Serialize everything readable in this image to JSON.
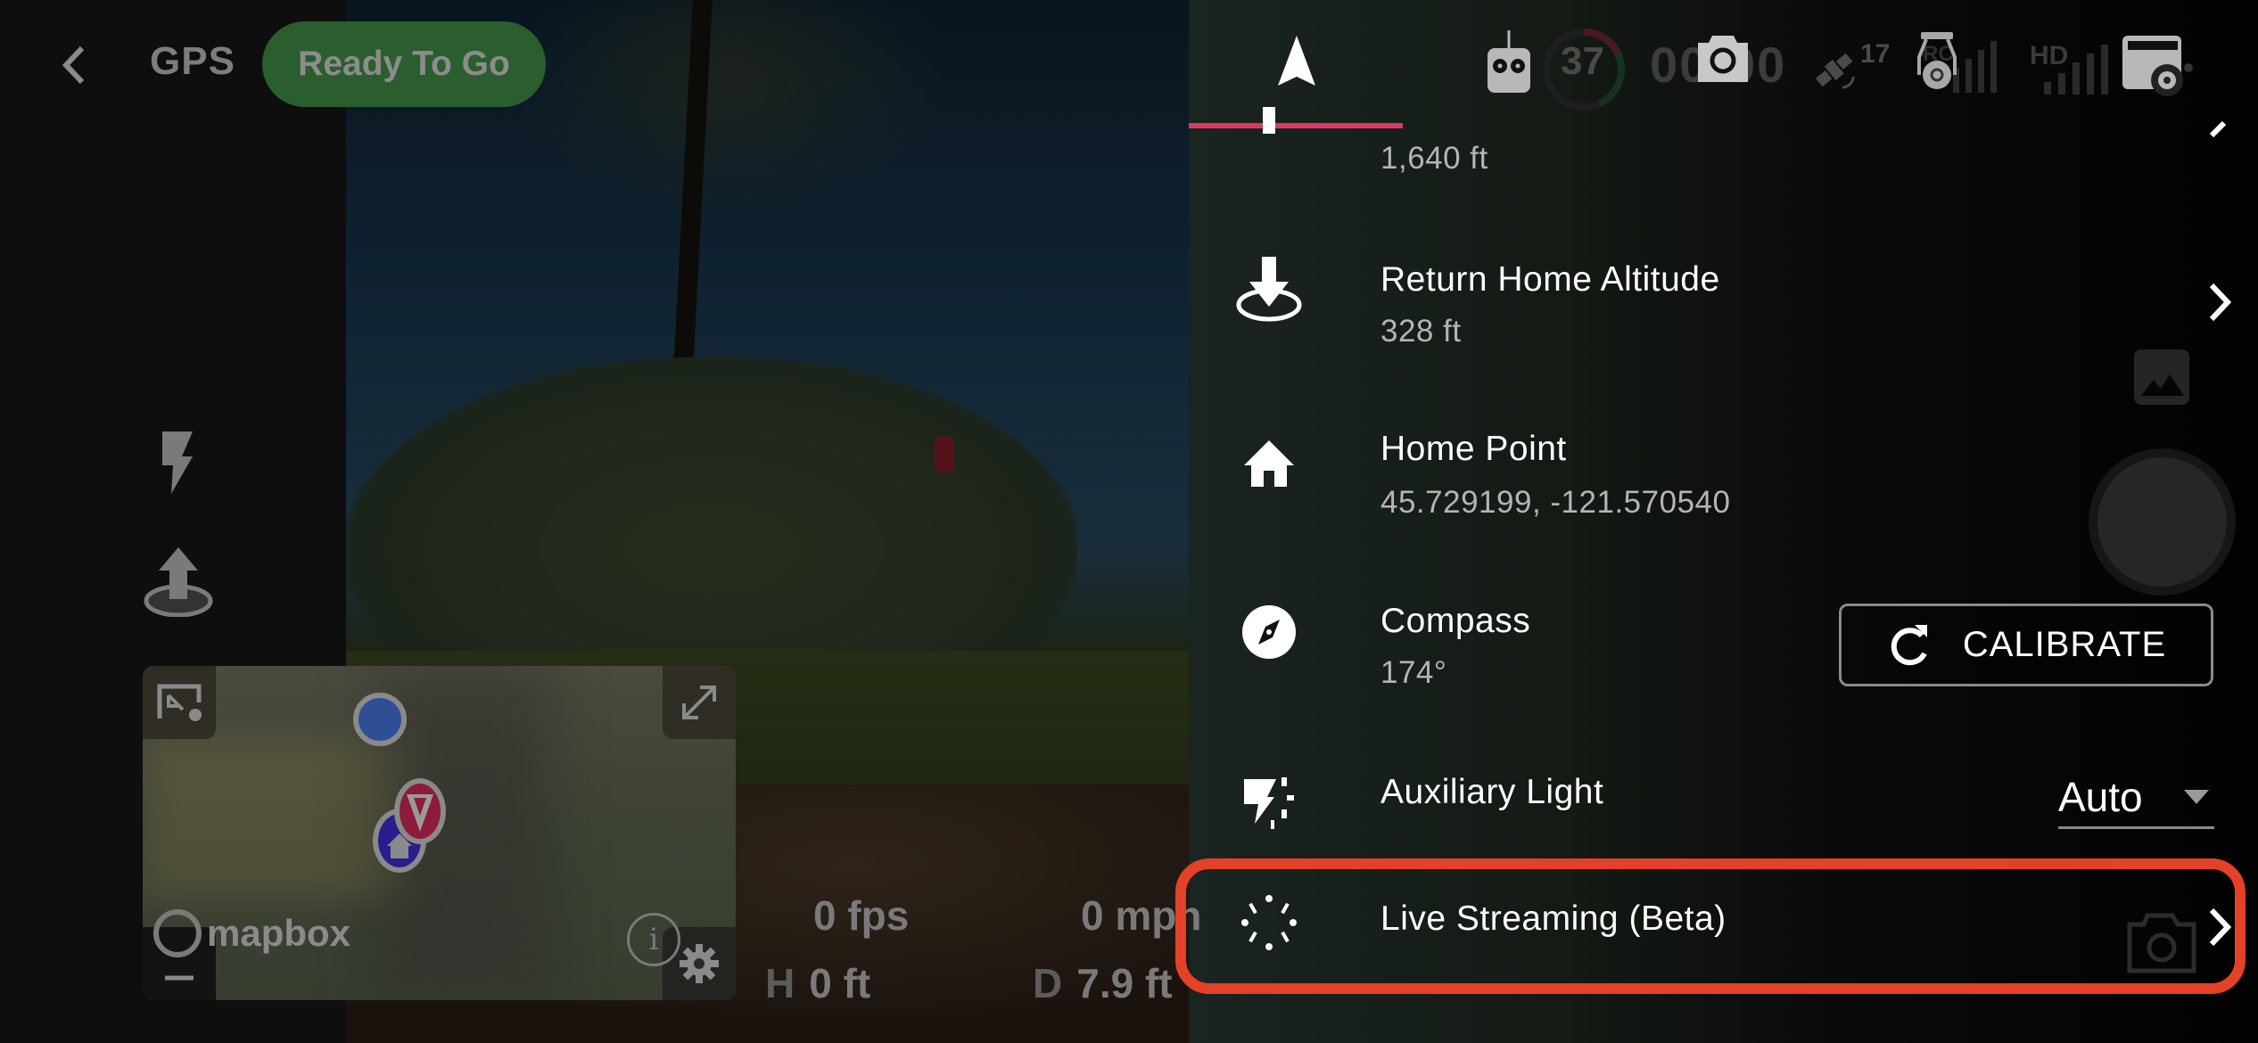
{
  "header": {
    "back_label": "Back",
    "gps_label": "GPS",
    "status_pill": "Ready To Go",
    "status_color": "#2a5e2e"
  },
  "status_bar": {
    "remote_icon": "remote-controller-icon",
    "battery_percent": "37",
    "timer": "00:00",
    "camera_icon": "camera-icon",
    "satellite_count": "17",
    "rc_signal_label": "RC",
    "hd_signal_label": "HD",
    "settings_icon": "camera-settings-icon"
  },
  "nav_tab": {
    "icon": "navigation-arrow-icon",
    "accent_color": "#dc3a62"
  },
  "left_tools": [
    {
      "name": "flash",
      "icon": "lightning-icon"
    },
    {
      "name": "takeoff",
      "icon": "takeoff-icon"
    }
  ],
  "minimap": {
    "attribution": "mapbox",
    "info_glyph": "i"
  },
  "telemetry": {
    "frame_rate": "0 fps",
    "speed": "0 mph",
    "height_label": "H",
    "height_value": "0 ft",
    "distance_label": "D",
    "distance_value": "7.9 ft"
  },
  "settings": {
    "max_distance": {
      "value": "1,640 ft"
    },
    "return_home_altitude": {
      "title": "Return Home Altitude",
      "value": "328 ft"
    },
    "home_point": {
      "title": "Home Point",
      "value": "45.729199, -121.570540"
    },
    "compass": {
      "title": "Compass",
      "value": "174°",
      "button_label": "CALIBRATE"
    },
    "auxiliary_light": {
      "title": "Auxiliary Light",
      "selected": "Auto"
    },
    "live_streaming": {
      "title": "Live Streaming (Beta)"
    }
  },
  "highlight_color": "#e34128"
}
